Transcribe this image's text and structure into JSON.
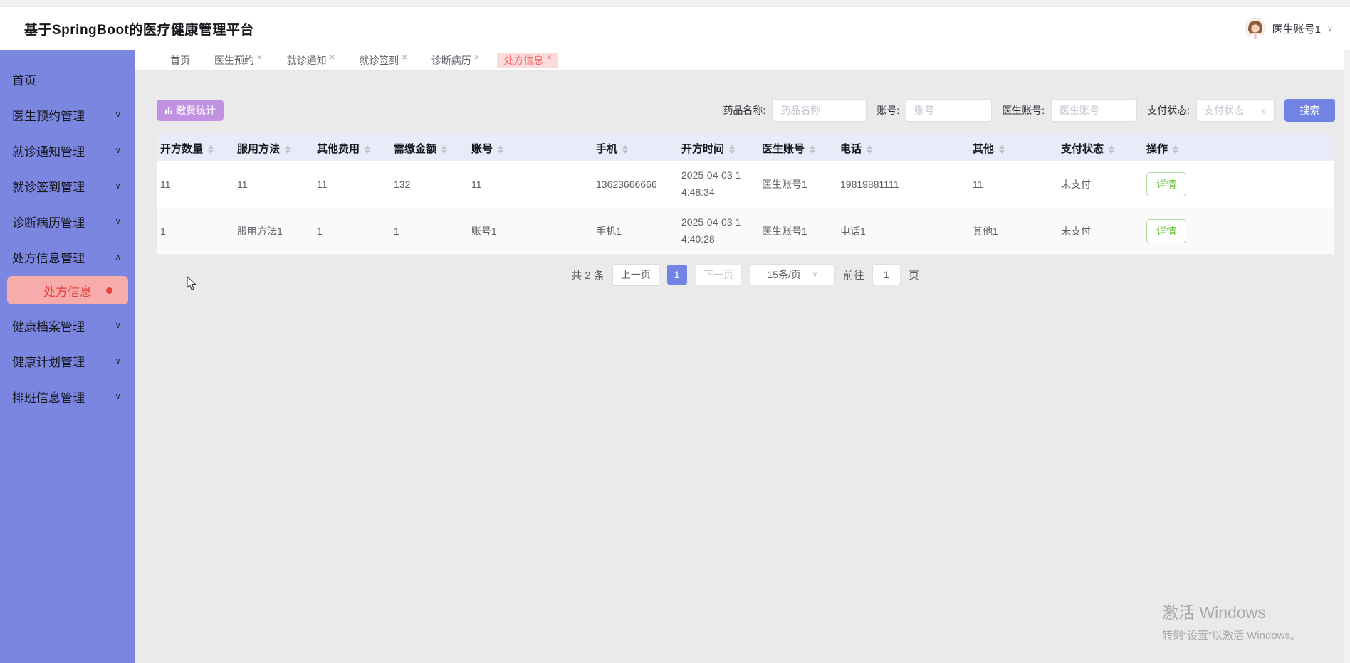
{
  "header": {
    "title": "基于SpringBoot的医疗健康管理平台",
    "user": {
      "name": "医生账号1"
    }
  },
  "sidebar": {
    "items": [
      {
        "label": "首页",
        "expandable": false
      },
      {
        "label": "医生预约管理",
        "expandable": true,
        "state": "collapsed"
      },
      {
        "label": "就诊通知管理",
        "expandable": true,
        "state": "collapsed"
      },
      {
        "label": "就诊签到管理",
        "expandable": true,
        "state": "collapsed"
      },
      {
        "label": "诊断病历管理",
        "expandable": true,
        "state": "collapsed"
      },
      {
        "label": "处方信息管理",
        "expandable": true,
        "state": "expanded",
        "children": [
          {
            "label": "处方信息",
            "active": true
          }
        ]
      },
      {
        "label": "健康档案管理",
        "expandable": true,
        "state": "collapsed"
      },
      {
        "label": "健康计划管理",
        "expandable": true,
        "state": "collapsed"
      },
      {
        "label": "排班信息管理",
        "expandable": true,
        "state": "collapsed"
      }
    ]
  },
  "tabs": [
    {
      "label": "首页",
      "closable": false,
      "active": false
    },
    {
      "label": "医生预约",
      "closable": true,
      "active": false
    },
    {
      "label": "就诊通知",
      "closable": true,
      "active": false
    },
    {
      "label": "就诊签到",
      "closable": true,
      "active": false
    },
    {
      "label": "诊断病历",
      "closable": true,
      "active": false
    },
    {
      "label": "处方信息",
      "closable": true,
      "active": true
    }
  ],
  "toolbar": {
    "stats_button": "缴费统计",
    "search_button": "搜索",
    "filters": [
      {
        "label": "药品名称:",
        "placeholder": "药品名称",
        "type": "input"
      },
      {
        "label": "账号:",
        "placeholder": "账号",
        "type": "input"
      },
      {
        "label": "医生账号:",
        "placeholder": "医生账号",
        "type": "input"
      },
      {
        "label": "支付状态:",
        "placeholder": "支付状态",
        "type": "select"
      }
    ]
  },
  "table": {
    "columns": [
      "开方数量",
      "服用方法",
      "其他费用",
      "需缴金额",
      "账号",
      "手机",
      "开方时间",
      "医生账号",
      "电话",
      "其他",
      "支付状态",
      "操作"
    ],
    "rows": [
      {
        "cells": [
          "11",
          "11",
          "11",
          "132",
          "11",
          "13623666666",
          "2025-04-03 14:48:34",
          "医生账号1",
          "19819881111",
          "11",
          "未支付"
        ],
        "action": "详情"
      },
      {
        "cells": [
          "1",
          "服用方法1",
          "1",
          "1",
          "账号1",
          "手机1",
          "2025-04-03 14:40:28",
          "医生账号1",
          "电话1",
          "其他1",
          "未支付"
        ],
        "action": "详情"
      }
    ]
  },
  "pagination": {
    "total_text": "共 2 条",
    "prev": "上一页",
    "current_page": "1",
    "next": "下一页",
    "page_size": "15条/页",
    "goto_label": "前往",
    "goto_value": "1",
    "goto_suffix": "页"
  },
  "watermark": {
    "line1": "激活 Windows",
    "line2": "转到“设置”以激活 Windows。"
  },
  "colors": {
    "sidebar_bg": "#7b86e1",
    "active_item_bg": "#f7abab",
    "active_item_text": "#e4403c",
    "tab_active_bg": "#fbdcdc",
    "tab_active_text": "#f56c6c",
    "stats_button": "#c192e2",
    "primary_blue": "#7383e4",
    "table_header_bg": "#e9ecf8",
    "detail_green": "#67c23a",
    "content_bg": "#eaeaeb"
  }
}
